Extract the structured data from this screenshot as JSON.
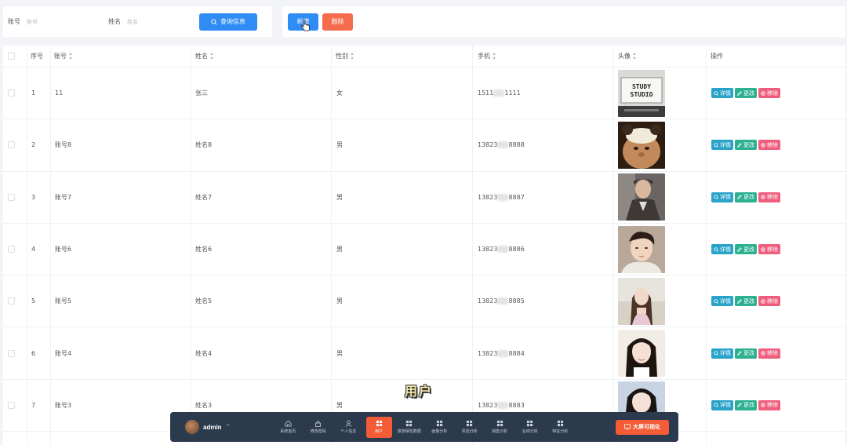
{
  "search": {
    "account_label": "账号",
    "account_placeholder": "账号",
    "name_label": "姓名",
    "name_placeholder": "姓名",
    "search_button": "查询信息"
  },
  "toolbar": {
    "add_button": "新增",
    "delete_button": "删除"
  },
  "table": {
    "columns": {
      "index": "序号",
      "account": "账号",
      "name": "姓名",
      "gender": "性别",
      "phone": "手机",
      "avatar": "头像",
      "actions": "操作"
    },
    "action_labels": {
      "detail": "详情",
      "edit": "更改",
      "remove": "移除"
    },
    "rows": [
      {
        "index": "1",
        "account": "11",
        "name": "张三",
        "gender": "女",
        "phone_a": "1511",
        "phone_b": "1111",
        "avatar_desc": "study-studio"
      },
      {
        "index": "2",
        "account": "账号8",
        "name": "姓名8",
        "gender": "男",
        "phone_a": "13823",
        "phone_b": "8888",
        "avatar_desc": "cat"
      },
      {
        "index": "3",
        "account": "账号7",
        "name": "姓名7",
        "gender": "男",
        "phone_a": "13823",
        "phone_b": "8887",
        "avatar_desc": "man-coat"
      },
      {
        "index": "4",
        "account": "账号6",
        "name": "姓名6",
        "gender": "男",
        "phone_a": "13823",
        "phone_b": "8886",
        "avatar_desc": "man-selfie"
      },
      {
        "index": "5",
        "account": "账号5",
        "name": "姓名5",
        "gender": "男",
        "phone_a": "13823",
        "phone_b": "8885",
        "avatar_desc": "woman-outdoor"
      },
      {
        "index": "6",
        "account": "账号4",
        "name": "姓名4",
        "gender": "男",
        "phone_a": "13823",
        "phone_b": "8884",
        "avatar_desc": "woman-bangs"
      },
      {
        "index": "7",
        "account": "账号3",
        "name": "姓名3",
        "gender": "男",
        "phone_a": "13823",
        "phone_b": "8883",
        "avatar_desc": "woman-dark-hair"
      }
    ]
  },
  "overlay": {
    "caption": "用户"
  },
  "dock": {
    "username": "admin",
    "items": [
      {
        "label": "系统首页",
        "icon": "home-icon"
      },
      {
        "label": "修改密码",
        "icon": "lock-icon"
      },
      {
        "label": "个人信息",
        "icon": "person-icon"
      },
      {
        "label": "用户",
        "icon": "grid-icon",
        "active": true
      },
      {
        "label": "旅游保险数据",
        "icon": "grid-icon"
      },
      {
        "label": "画像分析",
        "icon": "grid-icon"
      },
      {
        "label": "风险分析",
        "icon": "grid-icon"
      },
      {
        "label": "销售分析",
        "icon": "grid-icon"
      },
      {
        "label": "业绩分析",
        "icon": "grid-icon"
      },
      {
        "label": "特征分析",
        "icon": "grid-icon"
      }
    ],
    "cta": "大屏可视化"
  },
  "colors": {
    "primary": "#2f8cf4",
    "danger": "#f56b4e",
    "dock_bg": "#2c3a4e",
    "dock_active": "#f35c36",
    "op_detail": "#2aa3c9",
    "op_edit": "#2cb090",
    "op_remove": "#f05e7e"
  }
}
